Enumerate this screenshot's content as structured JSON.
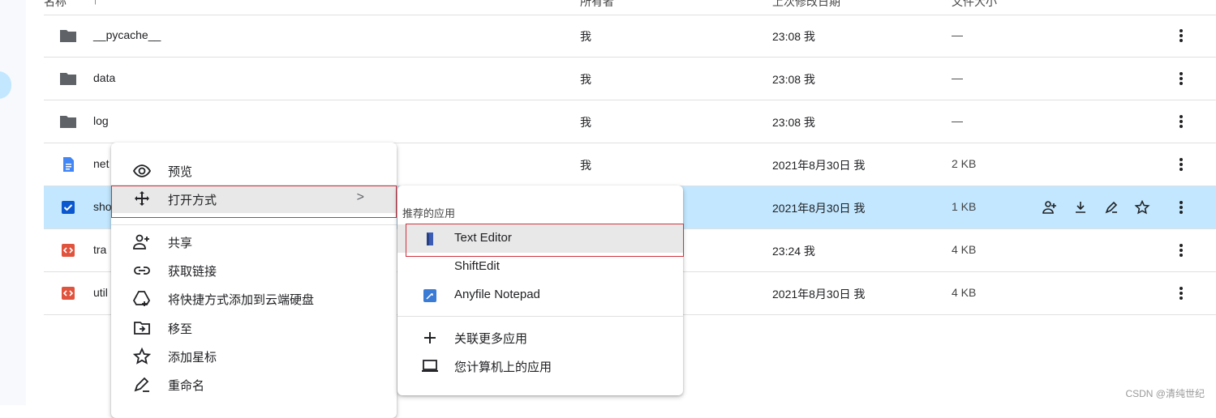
{
  "header": {
    "name": "名称",
    "sort": "↑",
    "owner": "所有者",
    "modified": "上次修改日期",
    "size": "文件大小"
  },
  "rows": [
    {
      "name": "__pycache__",
      "owner": "我",
      "modified": "23:08 我",
      "size": "—",
      "type": "folder"
    },
    {
      "name": "data",
      "owner": "我",
      "modified": "23:08 我",
      "size": "—",
      "type": "folder"
    },
    {
      "name": "log",
      "owner": "我",
      "modified": "23:08 我",
      "size": "—",
      "type": "folder"
    },
    {
      "name": "net",
      "owner": "我",
      "modified": "2021年8月30日 我",
      "size": "2 KB",
      "type": "doc"
    },
    {
      "name": "sho",
      "owner": "",
      "modified": "2021年8月30日 我",
      "size": "1 KB",
      "type": "checked"
    },
    {
      "name": "tra",
      "owner": "",
      "modified": "23:24 我",
      "size": "4 KB",
      "type": "code"
    },
    {
      "name": "util",
      "owner": "",
      "modified": "2021年8月30日 我",
      "size": "4 KB",
      "type": "code"
    }
  ],
  "context_menu": {
    "items": [
      {
        "label": "预览",
        "icon": "eye-icon"
      },
      {
        "label": "打开方式",
        "icon": "move-arrows-icon"
      },
      {
        "label": "共享",
        "icon": "person-add-icon"
      },
      {
        "label": "获取链接",
        "icon": "link-icon"
      },
      {
        "label": "将快捷方式添加到云端硬盘",
        "icon": "drive-shortcut-icon"
      },
      {
        "label": "移至",
        "icon": "move-to-folder-icon"
      },
      {
        "label": "添加星标",
        "icon": "star-icon"
      },
      {
        "label": "重命名",
        "icon": "rename-pen-icon"
      }
    ],
    "chevron": ">"
  },
  "submenu": {
    "title": "推荐的应用",
    "apps": [
      {
        "label": "Text Editor",
        "icon": "text-editor-icon"
      },
      {
        "label": "ShiftEdit",
        "icon": ""
      },
      {
        "label": "Anyfile Notepad",
        "icon": "anyfile-notepad-icon"
      }
    ],
    "more": {
      "label": "关联更多应用",
      "icon": "plus-icon"
    },
    "computer": {
      "label": "您计算机上的应用",
      "icon": "laptop-icon"
    }
  },
  "watermark": "CSDN @清纯世纪",
  "colors": {
    "selected_row": "#c2e7ff",
    "highlight_border": "#d0323d",
    "folder": "#5f6368",
    "doc": "#4285f4",
    "code": "#e0533d"
  }
}
